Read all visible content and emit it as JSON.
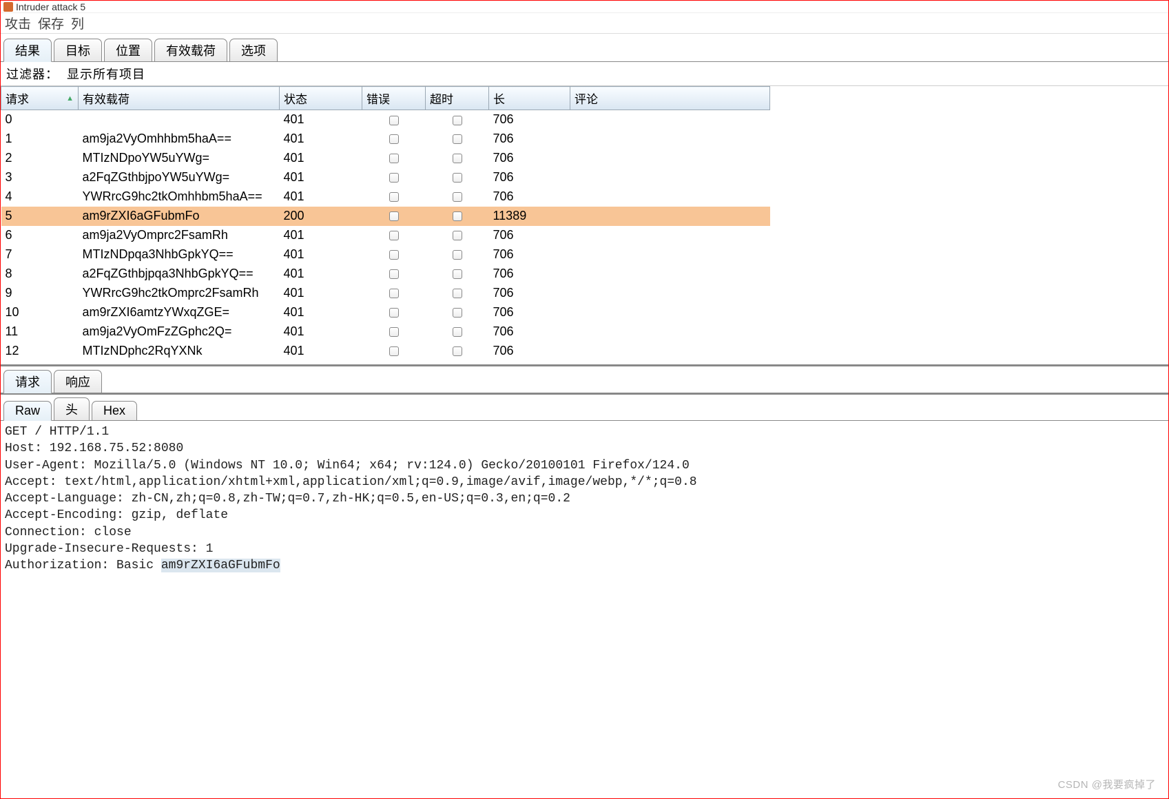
{
  "window": {
    "title": "Intruder attack 5"
  },
  "menubar": {
    "items": [
      "攻击",
      "保存",
      "列"
    ]
  },
  "main_tabs": {
    "items": [
      "结果",
      "目标",
      "位置",
      "有效载荷",
      "选项"
    ],
    "active": 0
  },
  "filter": {
    "label": "过滤器：",
    "text": "显示所有项目"
  },
  "columns": {
    "request": "请求",
    "payload": "有效载荷",
    "status": "状态",
    "error": "错误",
    "timeout": "超时",
    "length": "长",
    "comment": "评论"
  },
  "rows": [
    {
      "req": "0",
      "payload": "",
      "status": "401",
      "len": "706",
      "selected": false
    },
    {
      "req": "1",
      "payload": "am9ja2VyOmhhbm5haA==",
      "status": "401",
      "len": "706",
      "selected": false
    },
    {
      "req": "2",
      "payload": "MTIzNDpoYW5uYWg=",
      "status": "401",
      "len": "706",
      "selected": false
    },
    {
      "req": "3",
      "payload": "a2FqZGthbjpoYW5uYWg=",
      "status": "401",
      "len": "706",
      "selected": false
    },
    {
      "req": "4",
      "payload": "YWRrcG9hc2tkOmhhbm5haA==",
      "status": "401",
      "len": "706",
      "selected": false
    },
    {
      "req": "5",
      "payload": "am9rZXI6aGFubmFo",
      "status": "200",
      "len": "11389",
      "selected": true
    },
    {
      "req": "6",
      "payload": "am9ja2VyOmprc2FsamRh",
      "status": "401",
      "len": "706",
      "selected": false
    },
    {
      "req": "7",
      "payload": "MTIzNDpqa3NhbGpkYQ==",
      "status": "401",
      "len": "706",
      "selected": false
    },
    {
      "req": "8",
      "payload": "a2FqZGthbjpqa3NhbGpkYQ==",
      "status": "401",
      "len": "706",
      "selected": false
    },
    {
      "req": "9",
      "payload": "YWRrcG9hc2tkOmprc2FsamRh",
      "status": "401",
      "len": "706",
      "selected": false
    },
    {
      "req": "10",
      "payload": "am9rZXI6amtzYWxqZGE=",
      "status": "401",
      "len": "706",
      "selected": false
    },
    {
      "req": "11",
      "payload": "am9ja2VyOmFzZGphc2Q=",
      "status": "401",
      "len": "706",
      "selected": false
    },
    {
      "req": "12",
      "payload": "MTIzNDphc2RqYXNk",
      "status": "401",
      "len": "706",
      "selected": false
    }
  ],
  "lower_tabs": {
    "items": [
      "请求",
      "响应"
    ],
    "active": 0
  },
  "view_tabs": {
    "items": [
      "Raw",
      "头",
      "Hex"
    ],
    "active": 0
  },
  "raw": {
    "l0": "GET / HTTP/1.1",
    "l1": "Host: 192.168.75.52:8080",
    "l2": "User-Agent: Mozilla/5.0 (Windows NT 10.0; Win64; x64; rv:124.0) Gecko/20100101 Firefox/124.0",
    "l3": "Accept: text/html,application/xhtml+xml,application/xml;q=0.9,image/avif,image/webp,*/*;q=0.8",
    "l4": "Accept-Language: zh-CN,zh;q=0.8,zh-TW;q=0.7,zh-HK;q=0.5,en-US;q=0.3,en;q=0.2",
    "l5": "Accept-Encoding: gzip, deflate",
    "l6": "Connection: close",
    "l7": "Upgrade-Insecure-Requests: 1",
    "l8_pre": "Authorization: Basic ",
    "l8_hl": "am9rZXI6aGFubmFo"
  },
  "watermark": "CSDN @我要疯掉了"
}
